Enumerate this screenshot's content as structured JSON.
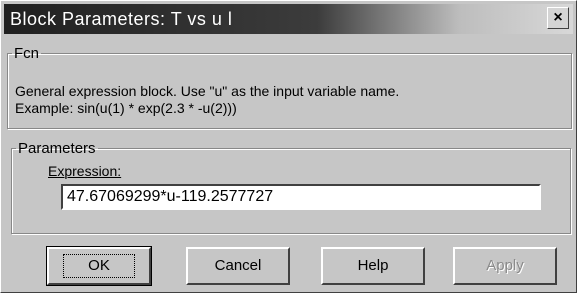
{
  "window": {
    "title": "Block Parameters: T vs u l",
    "close_label": "×"
  },
  "fcn_group": {
    "legend": "Fcn",
    "description_line1": "General expression block. Use \"u\" as the input variable name.",
    "description_line2": "Example: sin(u(1) * exp(2.3 * -u(2)))"
  },
  "parameters_group": {
    "legend": "Parameters",
    "expression_label": "Expression:",
    "expression_value": "47.67069299*u-119.2577727"
  },
  "buttons": {
    "ok": "OK",
    "cancel": "Cancel",
    "help": "Help",
    "apply": "Apply"
  }
}
